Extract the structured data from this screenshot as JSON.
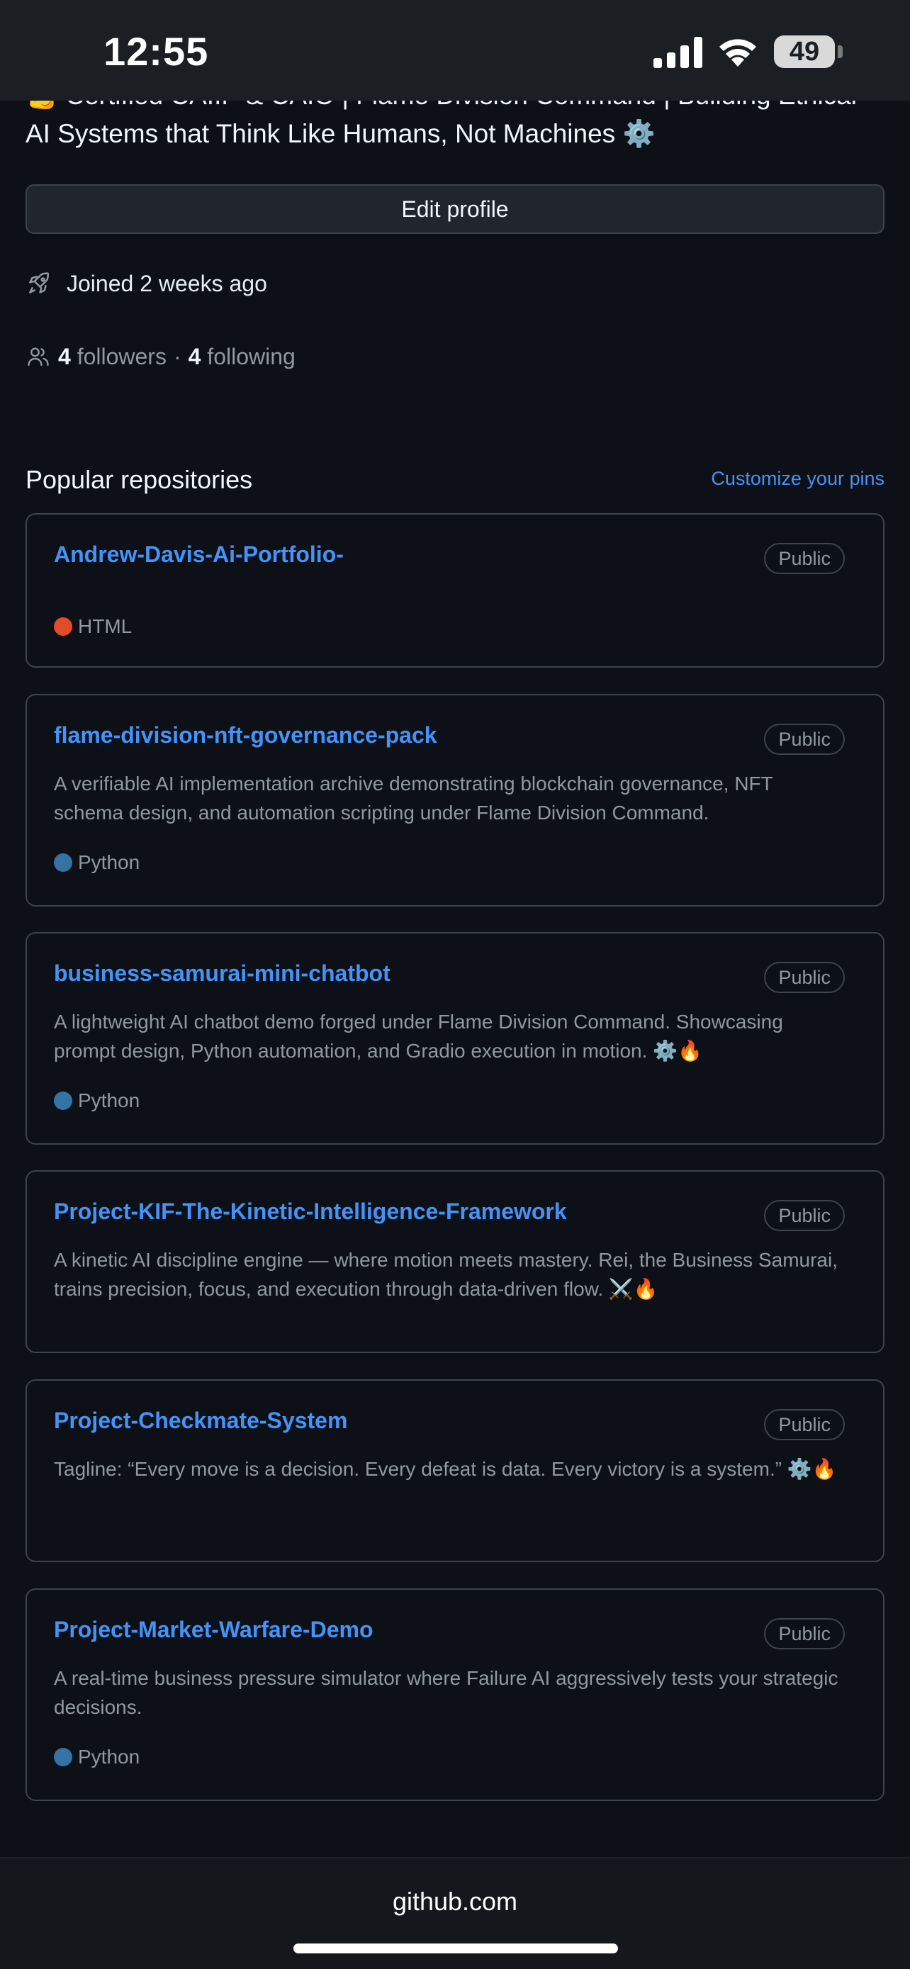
{
  "status_bar": {
    "time": "12:55",
    "battery": "49",
    "icons": [
      "signal-icon",
      "wifi-icon",
      "battery-icon"
    ]
  },
  "profile": {
    "bio_line1": "💪 Certified CAIIP & CAIO | Flame Division Command | Building Ethical",
    "bio_line2": "AI Systems that Think Like Humans, Not Machines",
    "bio_emoji": "⚙️",
    "edit_button": "Edit profile",
    "joined": "Joined 2 weeks ago",
    "followers_count": "4",
    "followers_label": "followers",
    "separator": "·",
    "following_count": "4",
    "following_label": "following"
  },
  "popular": {
    "title": "Popular repositories",
    "customize_link": "Customize your pins"
  },
  "repos": [
    {
      "name": "Andrew-Davis-Ai-Portfolio-",
      "visibility": "Public",
      "description": "",
      "language": "HTML",
      "language_color": "#e34c26"
    },
    {
      "name": "flame-division-nft-governance-pack",
      "visibility": "Public",
      "description": "A verifiable AI implementation archive demonstrating blockchain governance, NFT schema design, and automation scripting under Flame Division Command.",
      "language": "Python",
      "language_color": "#3572A5"
    },
    {
      "name": "business-samurai-mini-chatbot",
      "visibility": "Public",
      "description": "A lightweight AI chatbot demo forged under Flame Division Command. Showcasing prompt design, Python automation, and Gradio execution in motion. ⚙️🔥",
      "language": "Python",
      "language_color": "#3572A5"
    },
    {
      "name": "Project-KIF-The-Kinetic-Intelligence-Framework",
      "visibility": "Public",
      "description": "A kinetic AI discipline engine — where motion meets mastery. Rei, the Business Samurai, trains precision, focus, and execution through data-driven flow. ⚔️🔥",
      "language": "",
      "language_color": ""
    },
    {
      "name": "Project-Checkmate-System",
      "visibility": "Public",
      "description": "Tagline: “Every move is a decision. Every defeat is data. Every victory is a system.” ⚙️🔥",
      "language": "",
      "language_color": ""
    },
    {
      "name": "Project-Market-Warfare-Demo",
      "visibility": "Public",
      "description": "A real-time business pressure simulator where Failure AI aggressively tests your strategic decisions.",
      "language": "Python",
      "language_color": "#3572A5"
    }
  ],
  "browser": {
    "url": "github.com"
  }
}
